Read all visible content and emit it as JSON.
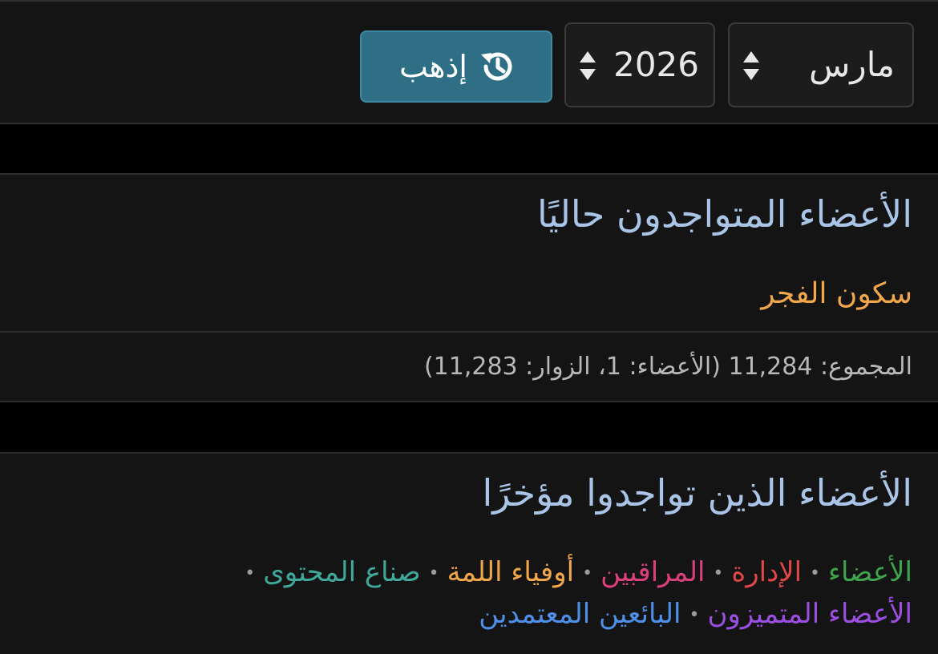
{
  "filter": {
    "month_value": "مارس",
    "year_value": "2026",
    "go_label": "إذهب"
  },
  "online": {
    "title": "الأعضاء المتواجدون حاليًا",
    "users": [
      "سكون الفجر"
    ],
    "stats": "المجموع: 11,284 (الأعضاء: 1، الزوار: 11,283)"
  },
  "recent": {
    "title": "الأعضاء الذين تواجدوا مؤخرًا"
  },
  "legend": {
    "groups": [
      {
        "label": "الأعضاء",
        "color": "#3fa34d"
      },
      {
        "label": "الإدارة",
        "color": "#e04848"
      },
      {
        "label": "المراقبين",
        "color": "#d9407c"
      },
      {
        "label": "أوفياء اللمة",
        "color": "#f0a64a"
      },
      {
        "label": "صناع المحتوى",
        "color": "#3fa89a"
      },
      {
        "label": "الأعضاء المتميزون",
        "color": "#9a4fe0"
      },
      {
        "label": "البائعين المعتمدين",
        "color": "#4f8fe8"
      }
    ]
  },
  "colors": {
    "title": "#a9c4e6",
    "online_user": "#f0a64a",
    "go_button": "#2f6f86"
  },
  "icons": {
    "go_button": "history-icon",
    "selects": "updown-arrows-icon"
  }
}
